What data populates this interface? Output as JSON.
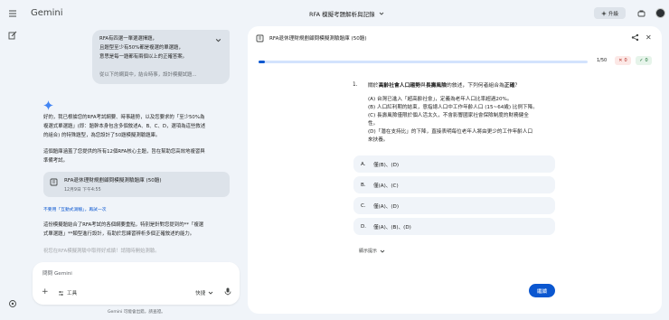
{
  "app": {
    "brand": "Gemini",
    "conversation_title": "RFA 模擬考題解析與記錄"
  },
  "header": {
    "upgrade_label": "升級"
  },
  "chat": {
    "user_message": [
      "RFA有四選一單選選擇題，",
      "且題型至少有50%都是複選的單選題，",
      "意思是每一題都有兩個以上的正確答案。",
      "",
      "從以下的網頁中，結合時事，設計模擬試題..."
    ],
    "response_paragraph1": [
      "好的，我已根據您的RFA考試綱要、時事趨勢，以及您要求的「至少50%為",
      "複選式單選題」(即：題幹本身包含多個敘述A、B、C、D，選項為這些敘述",
      "的組合) 的特殊題型，為您設計了50題模擬測驗題庫。"
    ],
    "response_paragraph2": [
      "這個題庫涵蓋了您提供的所有12個RFA核心主題，旨在幫助您高效地複習與",
      "準備考試。"
    ],
    "card": {
      "title": "RFA退休理財規劃顧問模擬測驗題庫 (50題)",
      "date": "12月9日 下午4:55"
    },
    "link_text": "不要用「互動式測驗」，再試一次",
    "response_paragraph3": [
      "這份模擬題結合了RFA考試的各個綱要重點，特別是針對您提到的**「複選",
      "式單選題」**類型進行設計，有助於您練習辨析多個正確敘述的能力。"
    ],
    "response_paragraph4": "祝您在RFA模擬測驗中取得好成績！請隨時開始測驗。",
    "composer": {
      "placeholder": "問問 Gemini",
      "tools_label": "工具",
      "mode_label": "快捷"
    },
    "disclaimer": "Gemini 可能會出錯，請查證。"
  },
  "quiz": {
    "title": "RFA退休理財規劃顧問模擬測驗題庫 (50題)",
    "progress_fraction": 0.02,
    "counter": "1/50",
    "wrong_count": "0",
    "right_count": "0",
    "question_number": "1.",
    "question_prefix": "關於",
    "question_bold1": "高齡社會人口趨勢",
    "question_mid": "與",
    "question_bold2": "長壽風險",
    "question_suffix": "的敘述，下列何者組合為",
    "question_bold3": "正確",
    "question_end": "？",
    "statements": [
      {
        "text": "(A) 台灣已進入「超高齡社會」，定義為老年人口比率超過20%。",
        "indent": false
      },
      {
        "text": "(B) 人口紅利期的結束，意指總人口中工作年齡人口 (15~64歲) 比例下降。",
        "indent": false
      },
      {
        "text": "(C) 長壽風險僅限於個人活太久，不會影響國家社會保險制度的財務健全",
        "indent": false
      },
      {
        "text": "性。",
        "indent": false
      },
      {
        "text": "(D)「潛在支持比」的下降，直接表明每位老年人將由更少的工作年齡人口",
        "indent": false
      },
      {
        "text": "來扶養。",
        "indent": false
      }
    ],
    "options": [
      {
        "letter": "A.",
        "text": "僅(B)、(D)"
      },
      {
        "letter": "B.",
        "text": "僅(A)、(C)"
      },
      {
        "letter": "C.",
        "text": "僅(A)、(D)"
      },
      {
        "letter": "D.",
        "text": "僅(A)、(B)、(D)"
      }
    ],
    "hint_label": "顯示提示",
    "next_label": "繼續"
  }
}
